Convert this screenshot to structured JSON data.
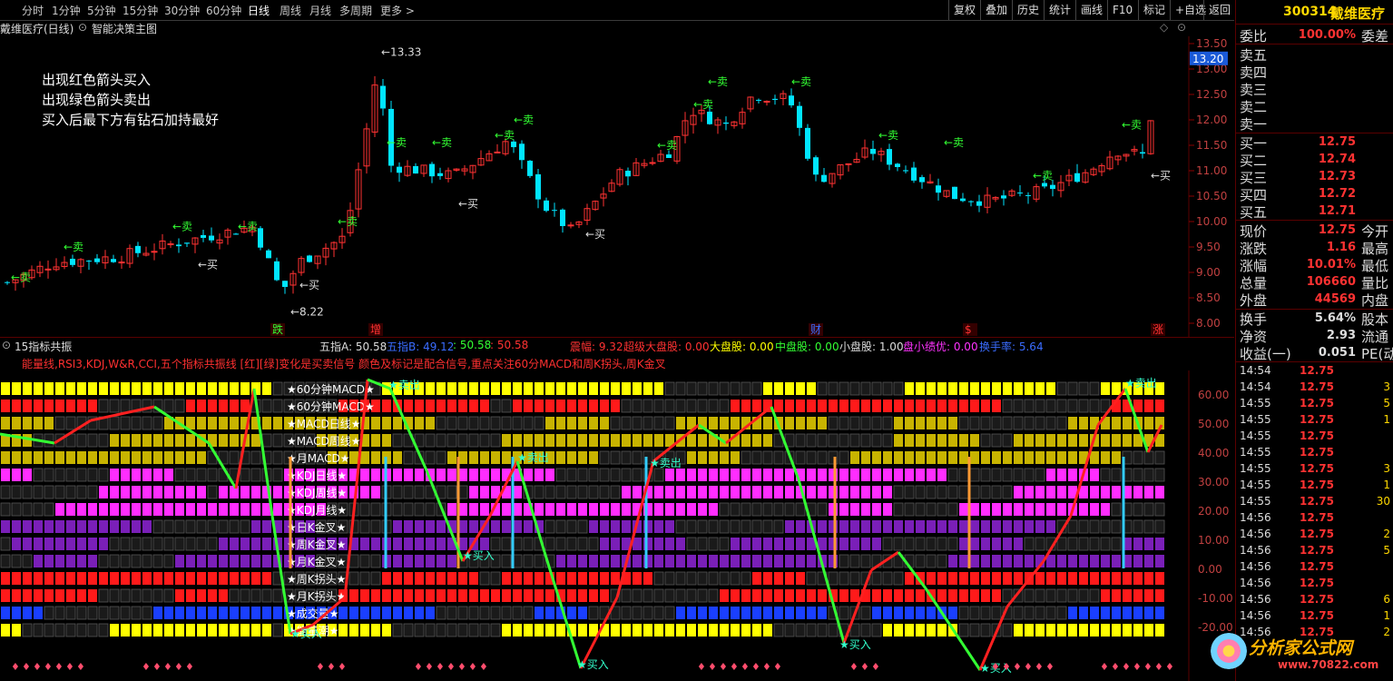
{
  "menu": {
    "items": [
      "分时",
      "1分钟",
      "5分钟",
      "15分钟",
      "30分钟",
      "60分钟",
      "日线",
      "周线",
      "月线",
      "多周期",
      "更多 >"
    ],
    "active": "日线",
    "right_buttons": [
      "复权",
      "叠加",
      "历史",
      "统计",
      "画线",
      "F10",
      "标记",
      "+自选",
      "返回"
    ]
  },
  "title": {
    "stock_name": "戴维医疗(日线)",
    "indicator": "智能决策主图"
  },
  "notes": [
    "出现红色箭头买入",
    "出现绿色箭头卖出",
    "买入后最下方有钻石加持最好"
  ],
  "price_axis": [
    "13.50",
    "13.00",
    "12.50",
    "12.00",
    "11.50",
    "11.00",
    "10.50",
    "10.00",
    "9.50",
    "9.00",
    "8.50",
    "8.00"
  ],
  "price_tag": "13.20",
  "high_label": "13.33",
  "low_label": "8.22",
  "signals": {
    "sell": "←卖",
    "buy": "←买",
    "buy2": "买入",
    "sell2": "卖出"
  },
  "event_marks": [
    "跌",
    "增",
    "财",
    "$",
    "涨"
  ],
  "sub": {
    "name": "15指标共振",
    "five_a": "五指A: 50.58",
    "five_b": "五指B: 49.12",
    "v1": ": 50.58",
    "v2": ": 50.58",
    "zhenfu": "震幅: 9.32",
    "super": "超级大盘股: 0.00",
    "big": "大盘股: 0.00",
    "mid": "中盘股: 0.00",
    "small": "小盘股: 1.00",
    "small_ex": "盘小绩优: 0.00",
    "turnover": "换手率: 5.64",
    "description": "能量线,RSI3,KDJ,W&R,CCI,五个指标共振线 [红][绿]变化是买卖信号 颜色及标记是配合信号,重点关注60分MACD和周K拐头,周K金叉",
    "rows": [
      "★60分钟MACD★",
      "★60分钟MACD★",
      "★MACD日线★",
      "★MACD周线★",
      "★月MACD★",
      "★KDJ日线★",
      "★KDJ周线★",
      "★KDJ月线★",
      "★日K金叉★",
      "★周K金叉★",
      "★月K金叉★",
      "★周K拐头★",
      "★月K拐头★",
      "★成交量★",
      "★能量潮★"
    ],
    "axis": [
      "60.00",
      "50.00",
      "40.00",
      "30.00",
      "20.00",
      "10.00",
      "0.00",
      "-10.00",
      "-20.00"
    ]
  },
  "quote": {
    "code": "300314",
    "name": "戴维医疗",
    "weibi_label": "委比",
    "weibi_value": "100.00%",
    "weicha_label": "委差",
    "asks": [
      "卖五",
      "卖四",
      "卖三",
      "卖二",
      "卖一"
    ],
    "bids": [
      {
        "label": "买一",
        "price": "12.75"
      },
      {
        "label": "买二",
        "price": "12.74"
      },
      {
        "label": "买三",
        "price": "12.73"
      },
      {
        "label": "买四",
        "price": "12.72"
      },
      {
        "label": "买五",
        "price": "12.71"
      }
    ],
    "stats": [
      {
        "label": "现价",
        "value": "12.75",
        "right": "今开"
      },
      {
        "label": "涨跌",
        "value": "1.16",
        "right": "最高"
      },
      {
        "label": "涨幅",
        "value": "10.01%",
        "right": "最低"
      },
      {
        "label": "总量",
        "value": "106660",
        "right": "量比"
      },
      {
        "label": "外盘",
        "value": "44569",
        "right": "内盘"
      }
    ],
    "stats2": [
      {
        "label": "换手",
        "value": "5.64%",
        "right": "股本"
      },
      {
        "label": "净资",
        "value": "2.93",
        "right": "流通"
      },
      {
        "label": "收益(一)",
        "value": "0.051",
        "right": "PE(动)"
      }
    ],
    "ticks": [
      {
        "t": "14:54",
        "p": "12.75",
        "q": ""
      },
      {
        "t": "14:54",
        "p": "12.75",
        "q": "3"
      },
      {
        "t": "14:55",
        "p": "12.75",
        "q": "5"
      },
      {
        "t": "14:55",
        "p": "12.75",
        "q": "1"
      },
      {
        "t": "14:55",
        "p": "12.75",
        "q": ""
      },
      {
        "t": "14:55",
        "p": "12.75",
        "q": ""
      },
      {
        "t": "14:55",
        "p": "12.75",
        "q": "3"
      },
      {
        "t": "14:55",
        "p": "12.75",
        "q": "1"
      },
      {
        "t": "14:55",
        "p": "12.75",
        "q": "30"
      },
      {
        "t": "14:56",
        "p": "12.75",
        "q": ""
      },
      {
        "t": "14:56",
        "p": "12.75",
        "q": "2"
      },
      {
        "t": "14:56",
        "p": "12.75",
        "q": "5"
      },
      {
        "t": "14:56",
        "p": "12.75",
        "q": ""
      },
      {
        "t": "14:56",
        "p": "12.75",
        "q": ""
      },
      {
        "t": "14:56",
        "p": "12.75",
        "q": "6"
      },
      {
        "t": "14:56",
        "p": "12.75",
        "q": "1"
      },
      {
        "t": "14:56",
        "p": "12.75",
        "q": "2"
      }
    ]
  },
  "watermark": {
    "name": "分析家公式网",
    "url": "www.70822.com"
  },
  "colors": {
    "up": "#ff3232",
    "down": "#00e5ff",
    "green": "#33ff33",
    "yellow": "#ffff00"
  }
}
